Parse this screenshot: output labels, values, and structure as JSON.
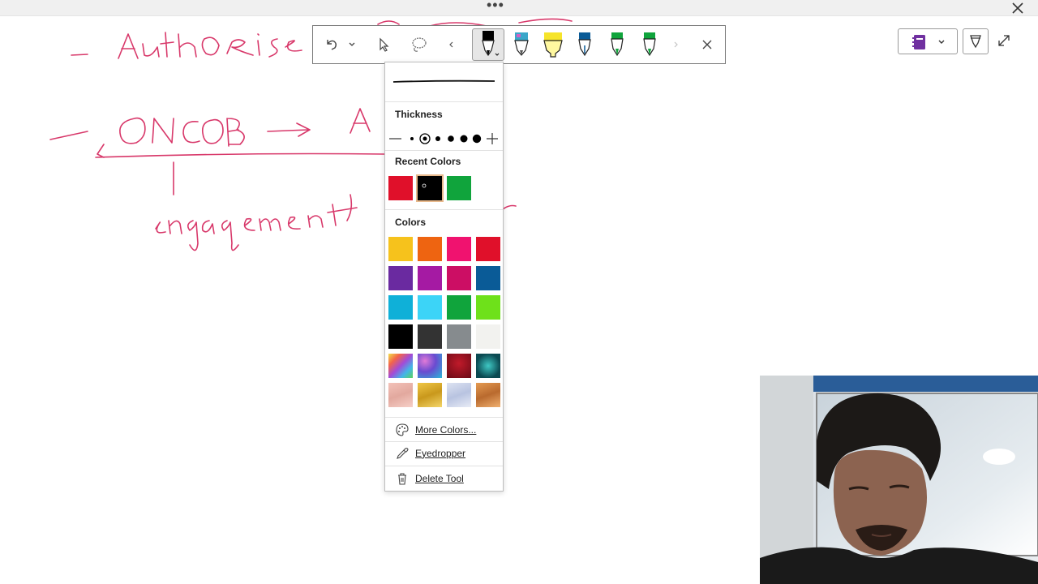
{
  "colors": {
    "ink": "#d8386a",
    "recent": [
      "#e0102a",
      "#000000",
      "#10a43c"
    ],
    "palette": [
      [
        "#f6c21c",
        "#ee6411",
        "#f0126f",
        "#e0102a"
      ],
      [
        "#6a2aa0",
        "#a51aa3",
        "#cc0e64",
        "#0a5b97"
      ],
      [
        "#0fb0d8",
        "#3cd4f7",
        "#10a43c",
        "#6ee11a"
      ],
      [
        "#000000",
        "#333333",
        "#868b8e",
        "#f2f2ef"
      ],
      [
        "rainbow",
        "galaxy",
        "ruby",
        "teal"
      ],
      [
        "rose-gold",
        "gold",
        "silver",
        "bronze"
      ]
    ]
  },
  "panel": {
    "thickness_label": "Thickness",
    "recent_label": "Recent Colors",
    "colors_label": "Colors",
    "more_colors": "More Colors...",
    "eyedropper": "Eyedropper",
    "delete_tool": "Delete Tool"
  },
  "toolbar": {
    "icons": [
      "undo-icon",
      "chevron-down-icon",
      "select-cursor-icon",
      "lasso-icon",
      "chevron-left-icon",
      "pen-black-icon",
      "pen-galaxy-icon",
      "highlighter-yellow-icon",
      "fountain-pen-blue-icon",
      "marker-green-icon",
      "marker-green-2-icon",
      "chevron-right-icon",
      "close-icon"
    ]
  }
}
